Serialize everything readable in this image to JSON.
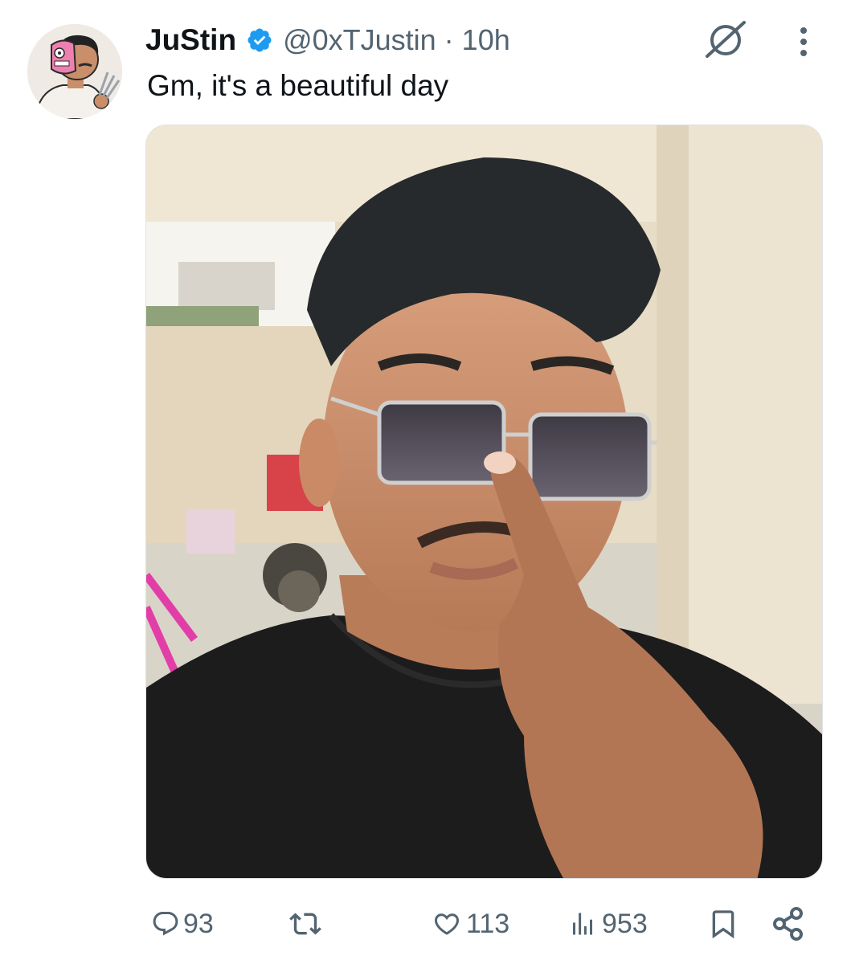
{
  "tweet": {
    "author_name": "JuStin",
    "handle": "@0xTJustin",
    "separator": "·",
    "time": "10h",
    "text": "Gm, it's a beautiful day"
  },
  "icons": {
    "verified": "verified-badge-icon",
    "grok": "grok-icon",
    "more": "more-icon",
    "reply": "reply-icon",
    "retweet": "retweet-icon",
    "like": "like-icon",
    "views": "views-icon",
    "bookmark": "bookmark-icon",
    "share": "share-icon"
  },
  "actions": {
    "replies": "93",
    "likes": "113",
    "views": "953"
  },
  "colors": {
    "text": "#0f1419",
    "secondary": "#536471",
    "verified": "#1d9bf0"
  }
}
